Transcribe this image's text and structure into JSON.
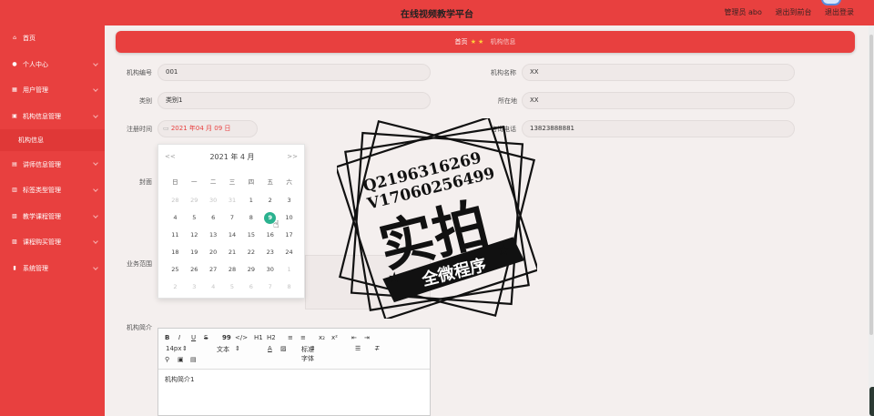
{
  "header": {
    "title": "在线视频教学平台",
    "user": "管理员 abo",
    "to_front": "退出到前台",
    "logout": "退出登录"
  },
  "sidebar": {
    "items": [
      {
        "label": "首页",
        "icon": "home-icon"
      },
      {
        "label": "个人中心",
        "icon": "user-icon"
      },
      {
        "label": "用户管理",
        "icon": "users-icon"
      },
      {
        "label": "机构信息管理",
        "icon": "building-icon"
      },
      {
        "label": "讲师信息管理",
        "icon": "teacher-icon"
      },
      {
        "label": "标签类型管理",
        "icon": "tag-icon"
      },
      {
        "label": "教学课程管理",
        "icon": "course-icon"
      },
      {
        "label": "课程购买管理",
        "icon": "cart-icon"
      },
      {
        "label": "系统管理",
        "icon": "chart-icon"
      }
    ],
    "sub_item": "机构信息"
  },
  "breadcrumb": {
    "home": "首页",
    "current": "机构信息"
  },
  "form": {
    "org_no_label": "机构编号",
    "org_no_value": "001",
    "org_name_label": "机构名称",
    "org_name_value": "XX",
    "category_label": "类别",
    "category_value": "类别1",
    "location_label": "所在地",
    "location_value": "XX",
    "reg_time_label": "注册时间",
    "reg_time_value": "2021 年04 月 09 日",
    "phone_label": "咨询电话",
    "phone_value": "13823888881",
    "cover_label": "封面",
    "biz_label": "业务范围",
    "intro_label": "机构简介"
  },
  "calendar": {
    "prev": "<<",
    "prev_month": "<",
    "title": "2021 年  4 月",
    "next_month": ">",
    "next": ">>",
    "weekdays": [
      "日",
      "一",
      "二",
      "三",
      "四",
      "五",
      "六"
    ],
    "days": [
      [
        "28",
        "29",
        "30",
        "31",
        "1",
        "2",
        "3"
      ],
      [
        "4",
        "5",
        "6",
        "7",
        "8",
        "9",
        "10"
      ],
      [
        "11",
        "12",
        "13",
        "14",
        "15",
        "16",
        "17"
      ],
      [
        "18",
        "19",
        "20",
        "21",
        "22",
        "23",
        "24"
      ],
      [
        "25",
        "26",
        "27",
        "28",
        "29",
        "30",
        "1"
      ],
      [
        "2",
        "3",
        "4",
        "5",
        "6",
        "7",
        "8"
      ]
    ],
    "selected": "9"
  },
  "editor": {
    "toolbar_row1": [
      "B",
      "I",
      "U",
      "S",
      "99",
      "</>",
      "H1",
      "H2",
      "≡",
      "≡",
      "x₂",
      "x²",
      "⇤",
      "⇥"
    ],
    "font_size": "14px",
    "text_style": "文本",
    "font_family": "标准字体",
    "content": "机构简介1"
  },
  "watermark": {
    "line1": "Q2196316269",
    "line2": "V17060256499",
    "big": "实拍",
    "banner": "全微程序"
  }
}
